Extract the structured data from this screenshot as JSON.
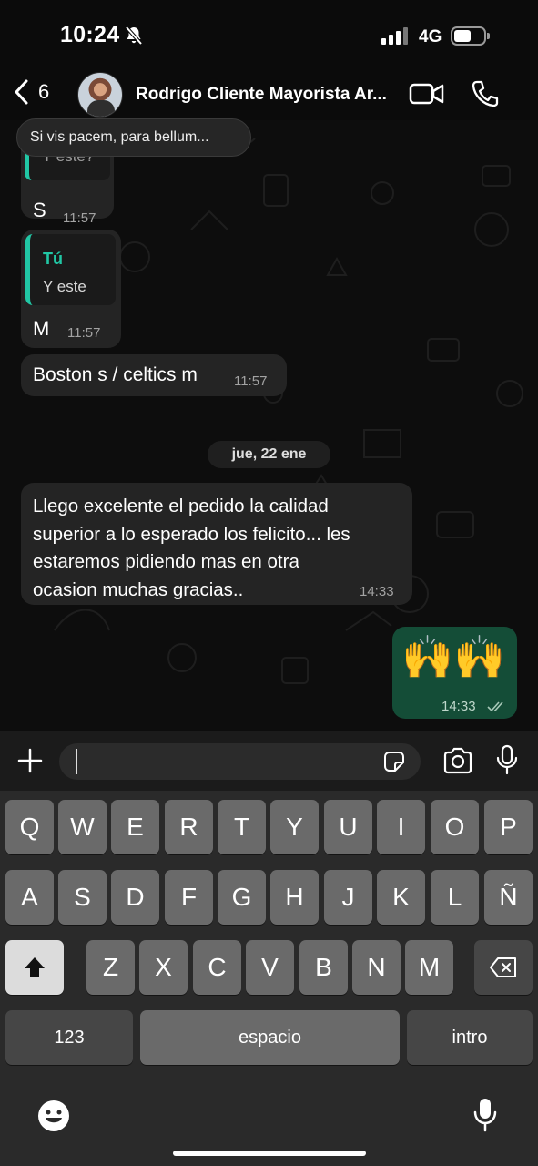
{
  "status_bar": {
    "time": "10:24",
    "network": "4G"
  },
  "header": {
    "back_count": "6",
    "contact_name": "Rodrigo Cliente Mayorista Ar..."
  },
  "tooltip": {
    "text": "Si vis pacem, para bellum..."
  },
  "messages": [
    {
      "partial_quote": "Y este?",
      "text": "S",
      "time": "11:57"
    },
    {
      "quote_author": "Tú",
      "quote_text": "Y este",
      "text": "M",
      "time": "11:57"
    },
    {
      "text": "Boston s / celtics m",
      "time": "11:57"
    },
    {
      "lines": [
        "Llego excelente el pedido la calidad",
        "superior a lo esperado los felicito... les",
        "estaremos pidiendo mas en otra",
        "ocasion muchas gracias.."
      ],
      "time": "14:33"
    },
    {
      "text": "🙌🙌",
      "time": "14:33"
    }
  ],
  "date_separator": "jue, 22 ene",
  "composer": {
    "input_value": ""
  },
  "keyboard": {
    "row1": [
      "Q",
      "W",
      "E",
      "R",
      "T",
      "Y",
      "U",
      "I",
      "O",
      "P"
    ],
    "row2": [
      "A",
      "S",
      "D",
      "F",
      "G",
      "H",
      "J",
      "K",
      "L",
      "Ñ"
    ],
    "row3": [
      "Z",
      "X",
      "C",
      "V",
      "B",
      "N",
      "M"
    ],
    "numbers": "123",
    "space": "espacio",
    "return": "intro"
  },
  "colors": {
    "accent": "#21c7a5",
    "outgoing_bubble": "#144d37",
    "incoming_bubble": "#242424"
  },
  "icons": [
    "bell-slash-icon",
    "back-chevron-icon",
    "video-call-icon",
    "phone-icon",
    "plus-icon",
    "sticker-icon",
    "camera-icon",
    "mic-icon",
    "shift-icon",
    "backspace-icon",
    "emoji-icon",
    "dictation-mic-icon",
    "read-receipt-icon"
  ]
}
